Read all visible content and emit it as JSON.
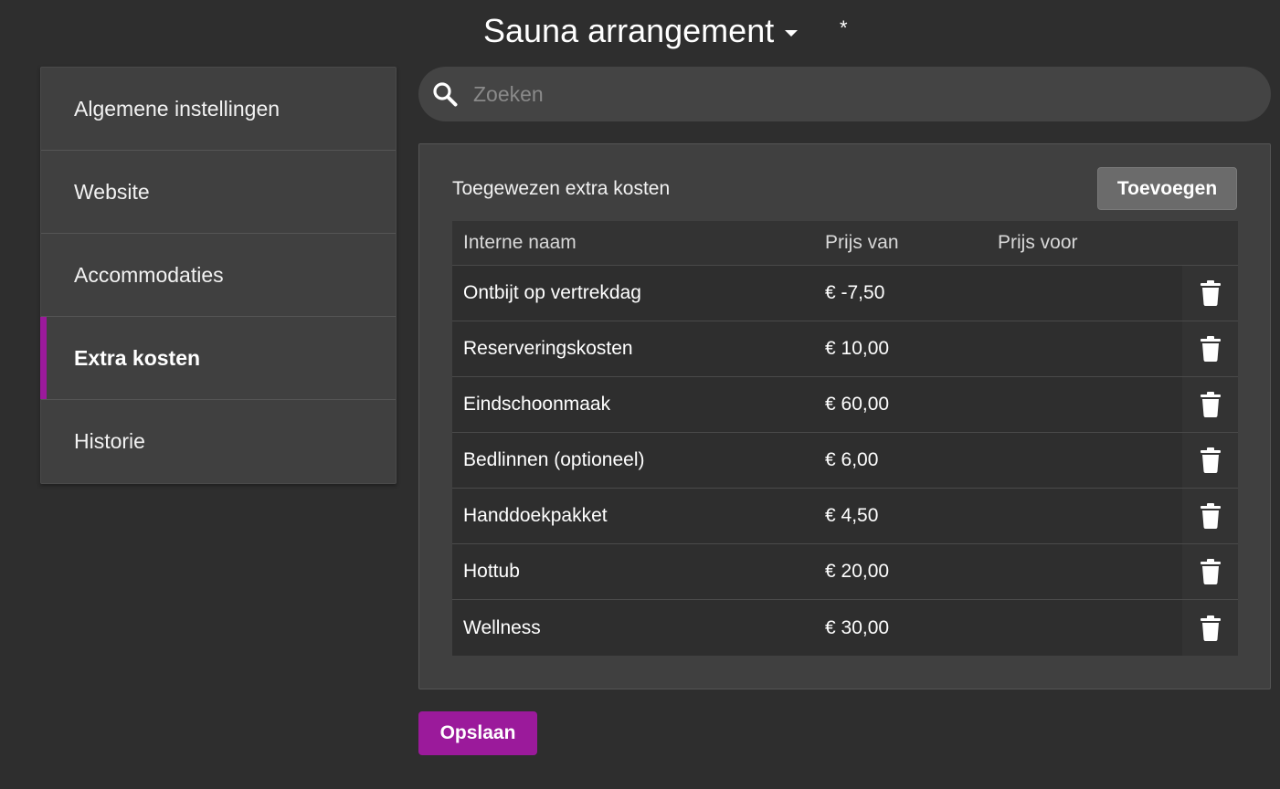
{
  "header": {
    "title": "Sauna arrangement",
    "unsaved_marker": "*"
  },
  "sidebar": {
    "items": [
      {
        "label": "Algemene instellingen",
        "active": false
      },
      {
        "label": "Website",
        "active": false
      },
      {
        "label": "Accommodaties",
        "active": false
      },
      {
        "label": "Extra kosten",
        "active": true
      },
      {
        "label": "Historie",
        "active": false
      }
    ]
  },
  "search": {
    "placeholder": "Zoeken",
    "value": ""
  },
  "panel": {
    "title": "Toegewezen extra kosten",
    "add_label": "Toevoegen",
    "table": {
      "headers": {
        "name": "Interne naam",
        "price_from": "Prijs van",
        "price_to": "Prijs voor"
      },
      "rows": [
        {
          "name": "Ontbijt op vertrekdag",
          "price_from": "€ -7,50",
          "price_to": ""
        },
        {
          "name": "Reserveringskosten",
          "price_from": "€ 10,00",
          "price_to": ""
        },
        {
          "name": "Eindschoonmaak",
          "price_from": "€ 60,00",
          "price_to": ""
        },
        {
          "name": "Bedlinnen (optioneel)",
          "price_from": "€ 6,00",
          "price_to": ""
        },
        {
          "name": "Handdoekpakket",
          "price_from": "€ 4,50",
          "price_to": ""
        },
        {
          "name": "Hottub",
          "price_from": "€ 20,00",
          "price_to": ""
        },
        {
          "name": "Wellness",
          "price_from": "€ 30,00",
          "price_to": ""
        }
      ]
    }
  },
  "footer": {
    "save_label": "Opslaan"
  },
  "colors": {
    "accent": "#9b1a9b",
    "background": "#2e2e2e",
    "panel": "#404040"
  },
  "icons": {
    "search": "search-icon",
    "delete": "trash-icon",
    "title_dropdown": "caret-down-icon"
  }
}
